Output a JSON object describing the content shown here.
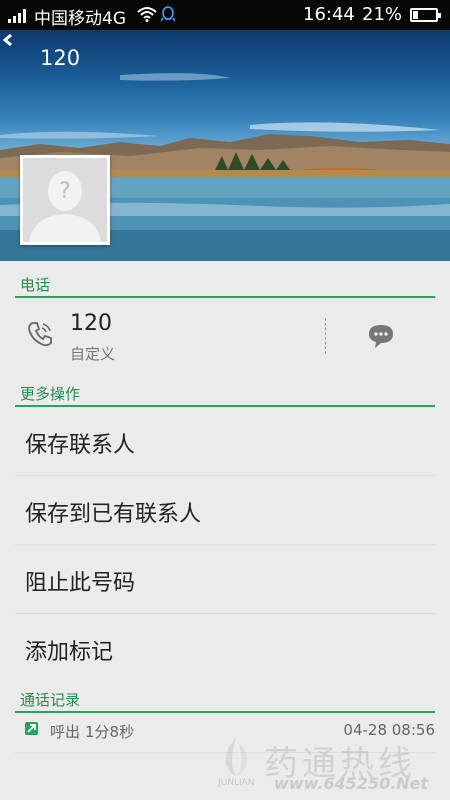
{
  "status_bar": {
    "carrier": "中国移动4G",
    "time": "16:44",
    "battery": "21%",
    "battery_level": 0.21,
    "icons": [
      "signal-icon",
      "wifi-icon",
      "qq-icon",
      "battery-icon"
    ]
  },
  "header": {
    "title": "120",
    "back_icon": "chevron-left-icon"
  },
  "phone_section": {
    "heading": "电话",
    "number": "120",
    "type": "自定义",
    "icons": [
      "phone-icon",
      "message-icon"
    ]
  },
  "more_section": {
    "heading": "更多操作",
    "items": [
      {
        "label": "保存联系人"
      },
      {
        "label": "保存到已有联系人"
      },
      {
        "label": "阻止此号码"
      },
      {
        "label": "添加标记"
      }
    ]
  },
  "call_log": {
    "heading": "通话记录",
    "entries": [
      {
        "type": "呼出",
        "duration": "1分8秒",
        "time": "04-28 08:56"
      }
    ]
  },
  "watermark": {
    "brand": "JUNLIAN",
    "text": "药通热线",
    "url": "www.645250.Net"
  },
  "colors": {
    "accent": "#2aa35f",
    "status_bar": "#070707",
    "background": "#ebebeb"
  }
}
